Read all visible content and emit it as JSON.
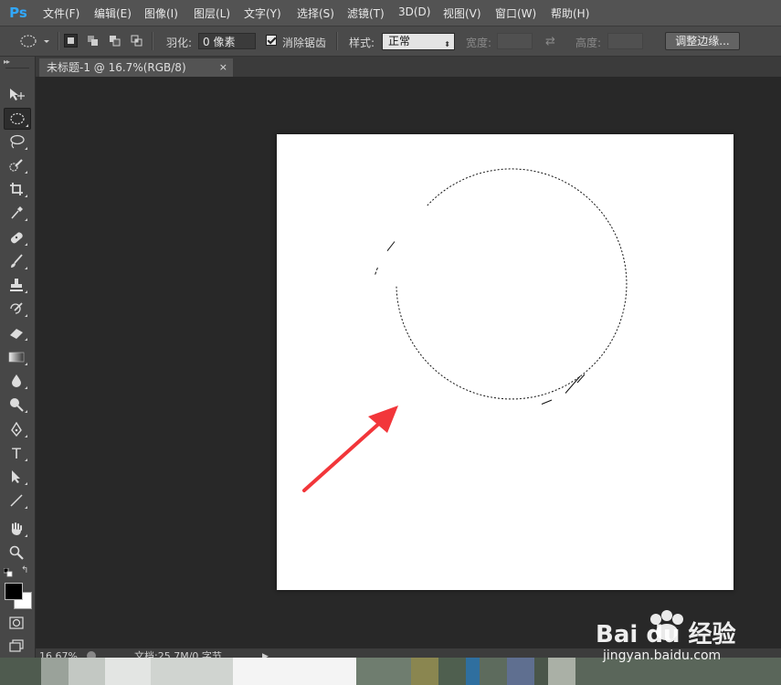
{
  "app": {
    "logo": "Ps"
  },
  "menu": {
    "items": [
      "文件(F)",
      "编辑(E)",
      "图像(I)",
      "图层(L)",
      "文字(Y)",
      "选择(S)",
      "滤镜(T)",
      "3D(D)",
      "视图(V)",
      "窗口(W)",
      "帮助(H)"
    ]
  },
  "options": {
    "feather_label": "羽化:",
    "feather_value": "0 像素",
    "antialias_label": "消除锯齿",
    "antialias_checked": true,
    "style_label": "样式:",
    "style_value": "正常",
    "width_label": "宽度:",
    "height_label": "高度:",
    "refine_button": "调整边缘..."
  },
  "document": {
    "tab_title": "未标题-1 @ 16.7%(RGB/8)",
    "tab_close": "×",
    "canvas_color": "#ffffff"
  },
  "status": {
    "zoom": "16.67%",
    "doc_info": "文档:25.7M/0 字节"
  },
  "tools": [
    "move-tool",
    "elliptical-marquee-tool",
    "lasso-tool",
    "quick-selection-tool",
    "crop-tool",
    "eyedropper-tool",
    "spot-healing-tool",
    "brush-tool",
    "clone-stamp-tool",
    "history-brush-tool",
    "eraser-tool",
    "gradient-tool",
    "blur-tool",
    "dodge-tool",
    "pen-tool",
    "type-tool",
    "path-selection-tool",
    "line-tool",
    "hand-tool",
    "zoom-tool"
  ],
  "colors": {
    "foreground": "#000000",
    "background": "#ffffff",
    "arrow": "#f2363a",
    "ui_bg": "#282828"
  },
  "watermark": {
    "brand": "Bai du 经验",
    "url": "jingyan.baidu.com"
  }
}
